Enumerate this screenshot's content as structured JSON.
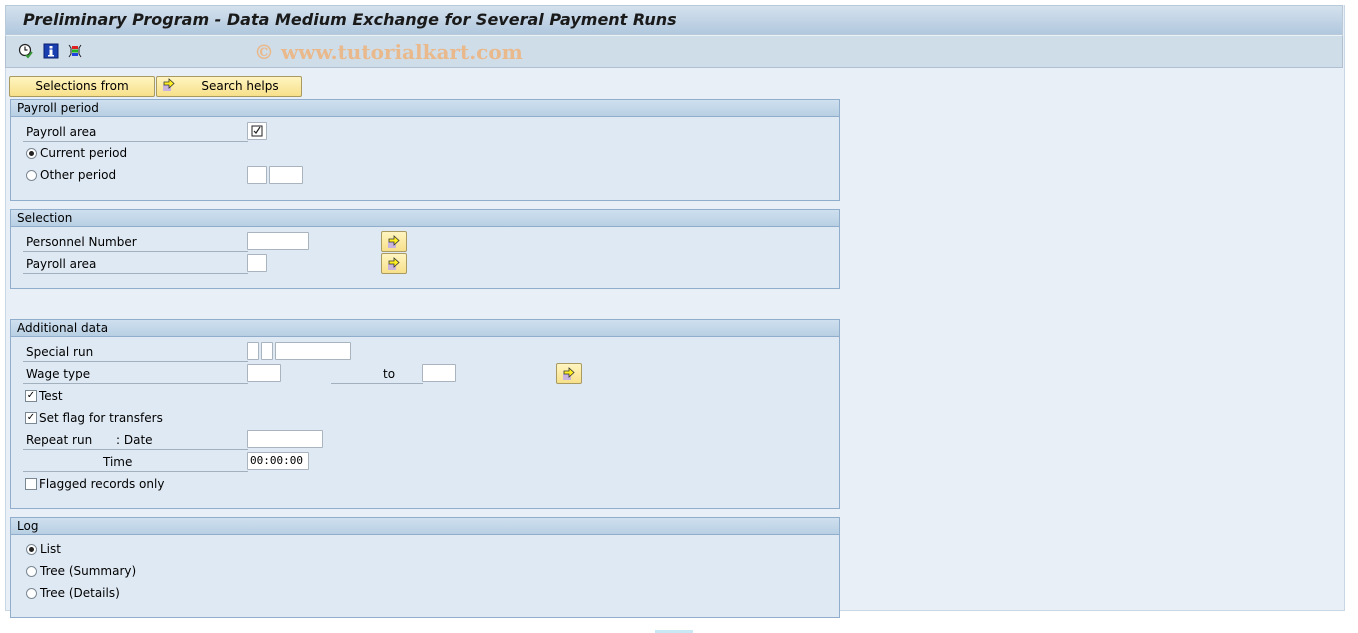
{
  "window": {
    "title": "Preliminary Program - Data Medium Exchange for Several Payment Runs",
    "watermark": "© www.tutorialkart.com"
  },
  "toolbar": {
    "icons": [
      "execute-clock-icon",
      "info-icon",
      "variant-icon"
    ]
  },
  "buttons": {
    "selections_from": "Selections from",
    "search_helps": "Search helps"
  },
  "payroll_period": {
    "title": "Payroll period",
    "payroll_area_label": "Payroll area",
    "payroll_area_checked": true,
    "current_period_label": "Current period",
    "current_period_selected": true,
    "other_period_label": "Other period",
    "other_period_selected": false,
    "other_period_value1": "",
    "other_period_value2": ""
  },
  "selection": {
    "title": "Selection",
    "personnel_number_label": "Personnel Number",
    "personnel_number_value": "",
    "payroll_area_label": "Payroll area",
    "payroll_area_value": ""
  },
  "additional_data": {
    "title": "Additional data",
    "special_run_label": "Special run",
    "special_run_values": [
      "",
      "",
      ""
    ],
    "wage_type_label": "Wage type",
    "wage_type_from": "",
    "to_label": "to",
    "wage_type_to": "",
    "test_label": "Test",
    "test_checked": true,
    "set_flag_label": "Set flag for transfers",
    "set_flag_checked": true,
    "repeat_run_label": "Repeat run",
    "date_label": ": Date",
    "date_value": "",
    "time_label": "Time",
    "time_value": "00:00:00",
    "flagged_only_label": "Flagged records only",
    "flagged_only_checked": false
  },
  "log": {
    "title": "Log",
    "options": [
      {
        "label": "List",
        "selected": true
      },
      {
        "label": "Tree (Summary)",
        "selected": false
      },
      {
        "label": "Tree (Details)",
        "selected": false
      }
    ]
  },
  "colors": {
    "title_bar": "#b1c8de",
    "button_yellow": "#f7e08a",
    "group_border": "#90aecb",
    "background": "#e8eff7"
  }
}
